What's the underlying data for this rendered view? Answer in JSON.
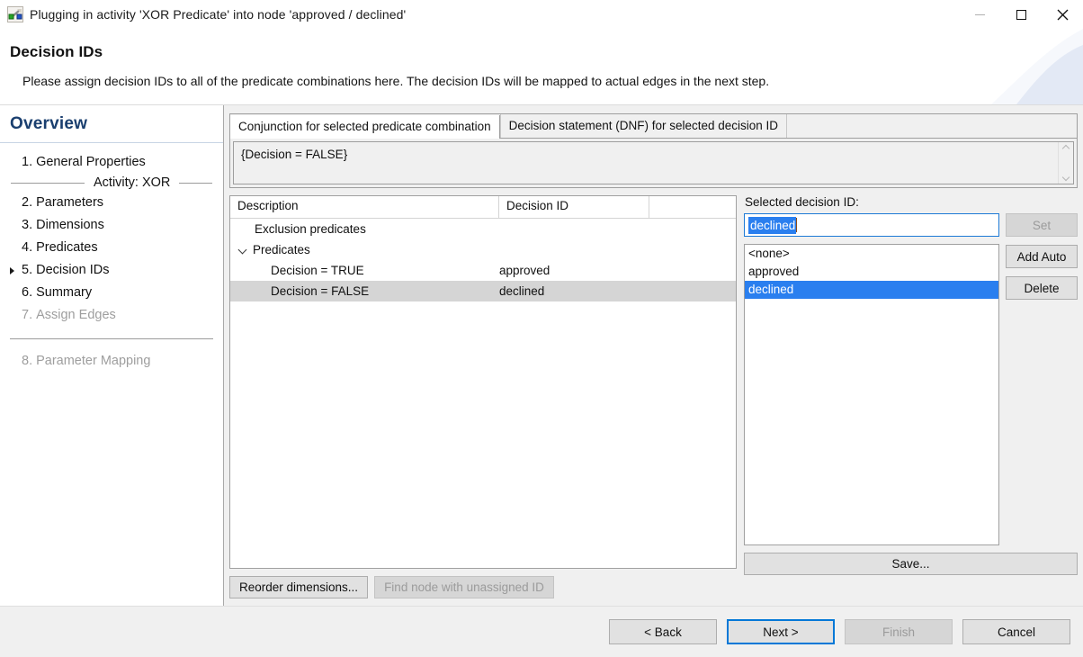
{
  "window": {
    "title": "Plugging in activity 'XOR Predicate' into node 'approved / declined'",
    "icon": "plug-connector-icon",
    "controls": {
      "minimize": "minimize-icon",
      "maximize": "maximize-icon",
      "close": "close-icon"
    }
  },
  "header": {
    "title": "Decision IDs",
    "description": "Please assign decision IDs to all of the predicate combinations here. The decision IDs will be mapped to actual edges in the next step."
  },
  "sidebar": {
    "title": "Overview",
    "items": [
      {
        "num": "1.",
        "label": "General Properties",
        "disabled": false,
        "current": false
      },
      {
        "num": "2.",
        "label": "Parameters",
        "disabled": false,
        "current": false
      },
      {
        "num": "3.",
        "label": "Dimensions",
        "disabled": false,
        "current": false
      },
      {
        "num": "4.",
        "label": "Predicates",
        "disabled": false,
        "current": false
      },
      {
        "num": "5.",
        "label": "Decision IDs",
        "disabled": false,
        "current": true
      },
      {
        "num": "6.",
        "label": "Summary",
        "disabled": false,
        "current": false
      },
      {
        "num": "7.",
        "label": "Assign Edges",
        "disabled": true,
        "current": false
      },
      {
        "num": "8.",
        "label": "Parameter Mapping",
        "disabled": true,
        "current": false
      }
    ],
    "separator_label": "Activity: XOR"
  },
  "tabs": [
    {
      "label": "Conjunction for selected predicate combination",
      "active": true
    },
    {
      "label": "Decision statement (DNF) for selected decision ID",
      "active": false
    }
  ],
  "statement": {
    "text": "{Decision = FALSE}",
    "scroll_up_icon": "chevron-up-icon",
    "scroll_down_icon": "chevron-down-icon"
  },
  "table": {
    "columns": [
      "Description",
      "Decision ID",
      ""
    ],
    "rows": [
      {
        "description": "Exclusion predicates",
        "decision_id": "",
        "indent": 2,
        "expandable": false,
        "selected": false
      },
      {
        "description": "Predicates",
        "decision_id": "",
        "indent": 1,
        "expandable": true,
        "expanded": true,
        "selected": false
      },
      {
        "description": "Decision = TRUE",
        "decision_id": "approved",
        "indent": 3,
        "expandable": false,
        "selected": false
      },
      {
        "description": "Decision = FALSE",
        "decision_id": "declined",
        "indent": 3,
        "expandable": false,
        "selected": true
      }
    ]
  },
  "table_buttons": {
    "reorder": {
      "label": "Reorder dimensions...",
      "disabled": false
    },
    "find_node": {
      "label": "Find node with unassigned ID",
      "disabled": true
    }
  },
  "right_panel": {
    "label": "Selected decision ID:",
    "input_value": "declined",
    "input_selected": true,
    "buttons": {
      "set": {
        "label": "Set",
        "disabled": true
      },
      "add_auto": {
        "label": "Add Auto",
        "disabled": false
      },
      "delete": {
        "label": "Delete",
        "disabled": false
      }
    },
    "list_items": [
      {
        "label": "<none>",
        "selected": false
      },
      {
        "label": "approved",
        "selected": false
      },
      {
        "label": "declined",
        "selected": true
      }
    ],
    "save": {
      "label": "Save...",
      "disabled": false
    }
  },
  "footer": {
    "back": {
      "label": "< Back",
      "disabled": false,
      "focused": false
    },
    "next": {
      "label": "Next >",
      "disabled": false,
      "focused": true
    },
    "finish": {
      "label": "Finish",
      "disabled": true,
      "focused": false
    },
    "cancel": {
      "label": "Cancel",
      "disabled": false,
      "focused": false
    }
  },
  "colors": {
    "selection_blue": "#2a7fef",
    "focus_blue": "#0078d7",
    "sidebar_title": "#1a3f6f",
    "row_selected_grey": "#d5d5d5"
  }
}
